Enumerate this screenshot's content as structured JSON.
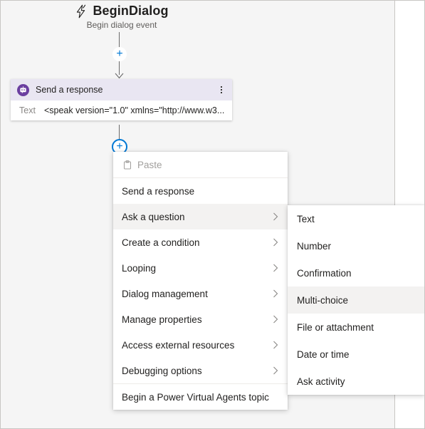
{
  "trigger": {
    "icon": "lightning-bolt-icon",
    "title": "BeginDialog",
    "subtitle": "Begin dialog event"
  },
  "node": {
    "icon": "send-response-icon",
    "title": "Send a response",
    "menu_icon": "more-vertical-icon",
    "field_label": "Text",
    "field_value": "<speak version=\"1.0\" xmlns=\"http://www.w3...."
  },
  "add_buttons": {
    "top_label": "+",
    "bottom_label": "+"
  },
  "context_menu": {
    "items": [
      {
        "label": "Paste",
        "icon": "clipboard-icon",
        "disabled": true,
        "submenu": false,
        "selected": false
      },
      {
        "label": "Send a response",
        "icon": "",
        "disabled": false,
        "submenu": false,
        "selected": false
      },
      {
        "label": "Ask a question",
        "icon": "",
        "disabled": false,
        "submenu": true,
        "selected": true
      },
      {
        "label": "Create a condition",
        "icon": "",
        "disabled": false,
        "submenu": true,
        "selected": false
      },
      {
        "label": "Looping",
        "icon": "",
        "disabled": false,
        "submenu": true,
        "selected": false
      },
      {
        "label": "Dialog management",
        "icon": "",
        "disabled": false,
        "submenu": true,
        "selected": false
      },
      {
        "label": "Manage properties",
        "icon": "",
        "disabled": false,
        "submenu": true,
        "selected": false
      },
      {
        "label": "Access external resources",
        "icon": "",
        "disabled": false,
        "submenu": true,
        "selected": false
      },
      {
        "label": "Debugging options",
        "icon": "",
        "disabled": false,
        "submenu": true,
        "selected": false
      },
      {
        "label": "Begin a Power Virtual Agents topic",
        "icon": "",
        "disabled": false,
        "submenu": false,
        "selected": false
      }
    ]
  },
  "submenu": {
    "items": [
      {
        "label": "Text",
        "selected": false
      },
      {
        "label": "Number",
        "selected": false
      },
      {
        "label": "Confirmation",
        "selected": false
      },
      {
        "label": "Multi-choice",
        "selected": true
      },
      {
        "label": "File or attachment",
        "selected": false
      },
      {
        "label": "Date or time",
        "selected": false
      },
      {
        "label": "Ask activity",
        "selected": false
      }
    ]
  },
  "colors": {
    "accent": "#0078d4",
    "node_icon": "#6b3fa0",
    "node_header": "#e9e6f2",
    "canvas": "#f5f5f5",
    "selected_row": "#f3f2f1"
  }
}
